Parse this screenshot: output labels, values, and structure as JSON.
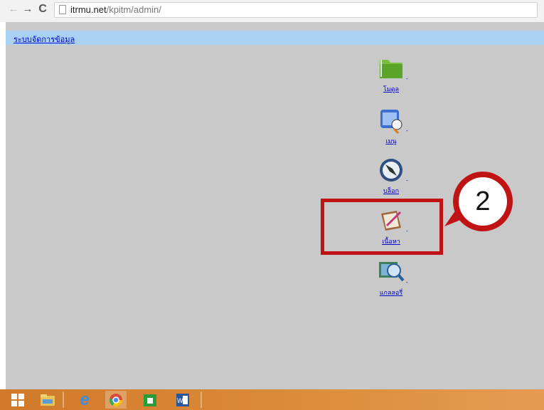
{
  "browser": {
    "url_host": "itrmu.net",
    "url_path": "/kpitm/admin/"
  },
  "page": {
    "title_link": "ระบบจัดการข้อมูล",
    "items": [
      {
        "label": "โมดูล",
        "icon": "folder-icon"
      },
      {
        "label": "เมนู",
        "icon": "menu-window-icon"
      },
      {
        "label": "บล็อก",
        "icon": "compass-icon"
      },
      {
        "label": "เนื้อหา",
        "icon": "notepad-pen-icon"
      },
      {
        "label": "แกลลอรี่",
        "icon": "gallery-search-icon"
      }
    ],
    "dash": "-"
  },
  "annotation": {
    "number": "2",
    "color": "#c01414"
  },
  "taskbar": {
    "apps": [
      "start-icon",
      "file-explorer-icon",
      "internet-explorer-icon",
      "chrome-icon",
      "store-icon",
      "word-icon"
    ]
  }
}
